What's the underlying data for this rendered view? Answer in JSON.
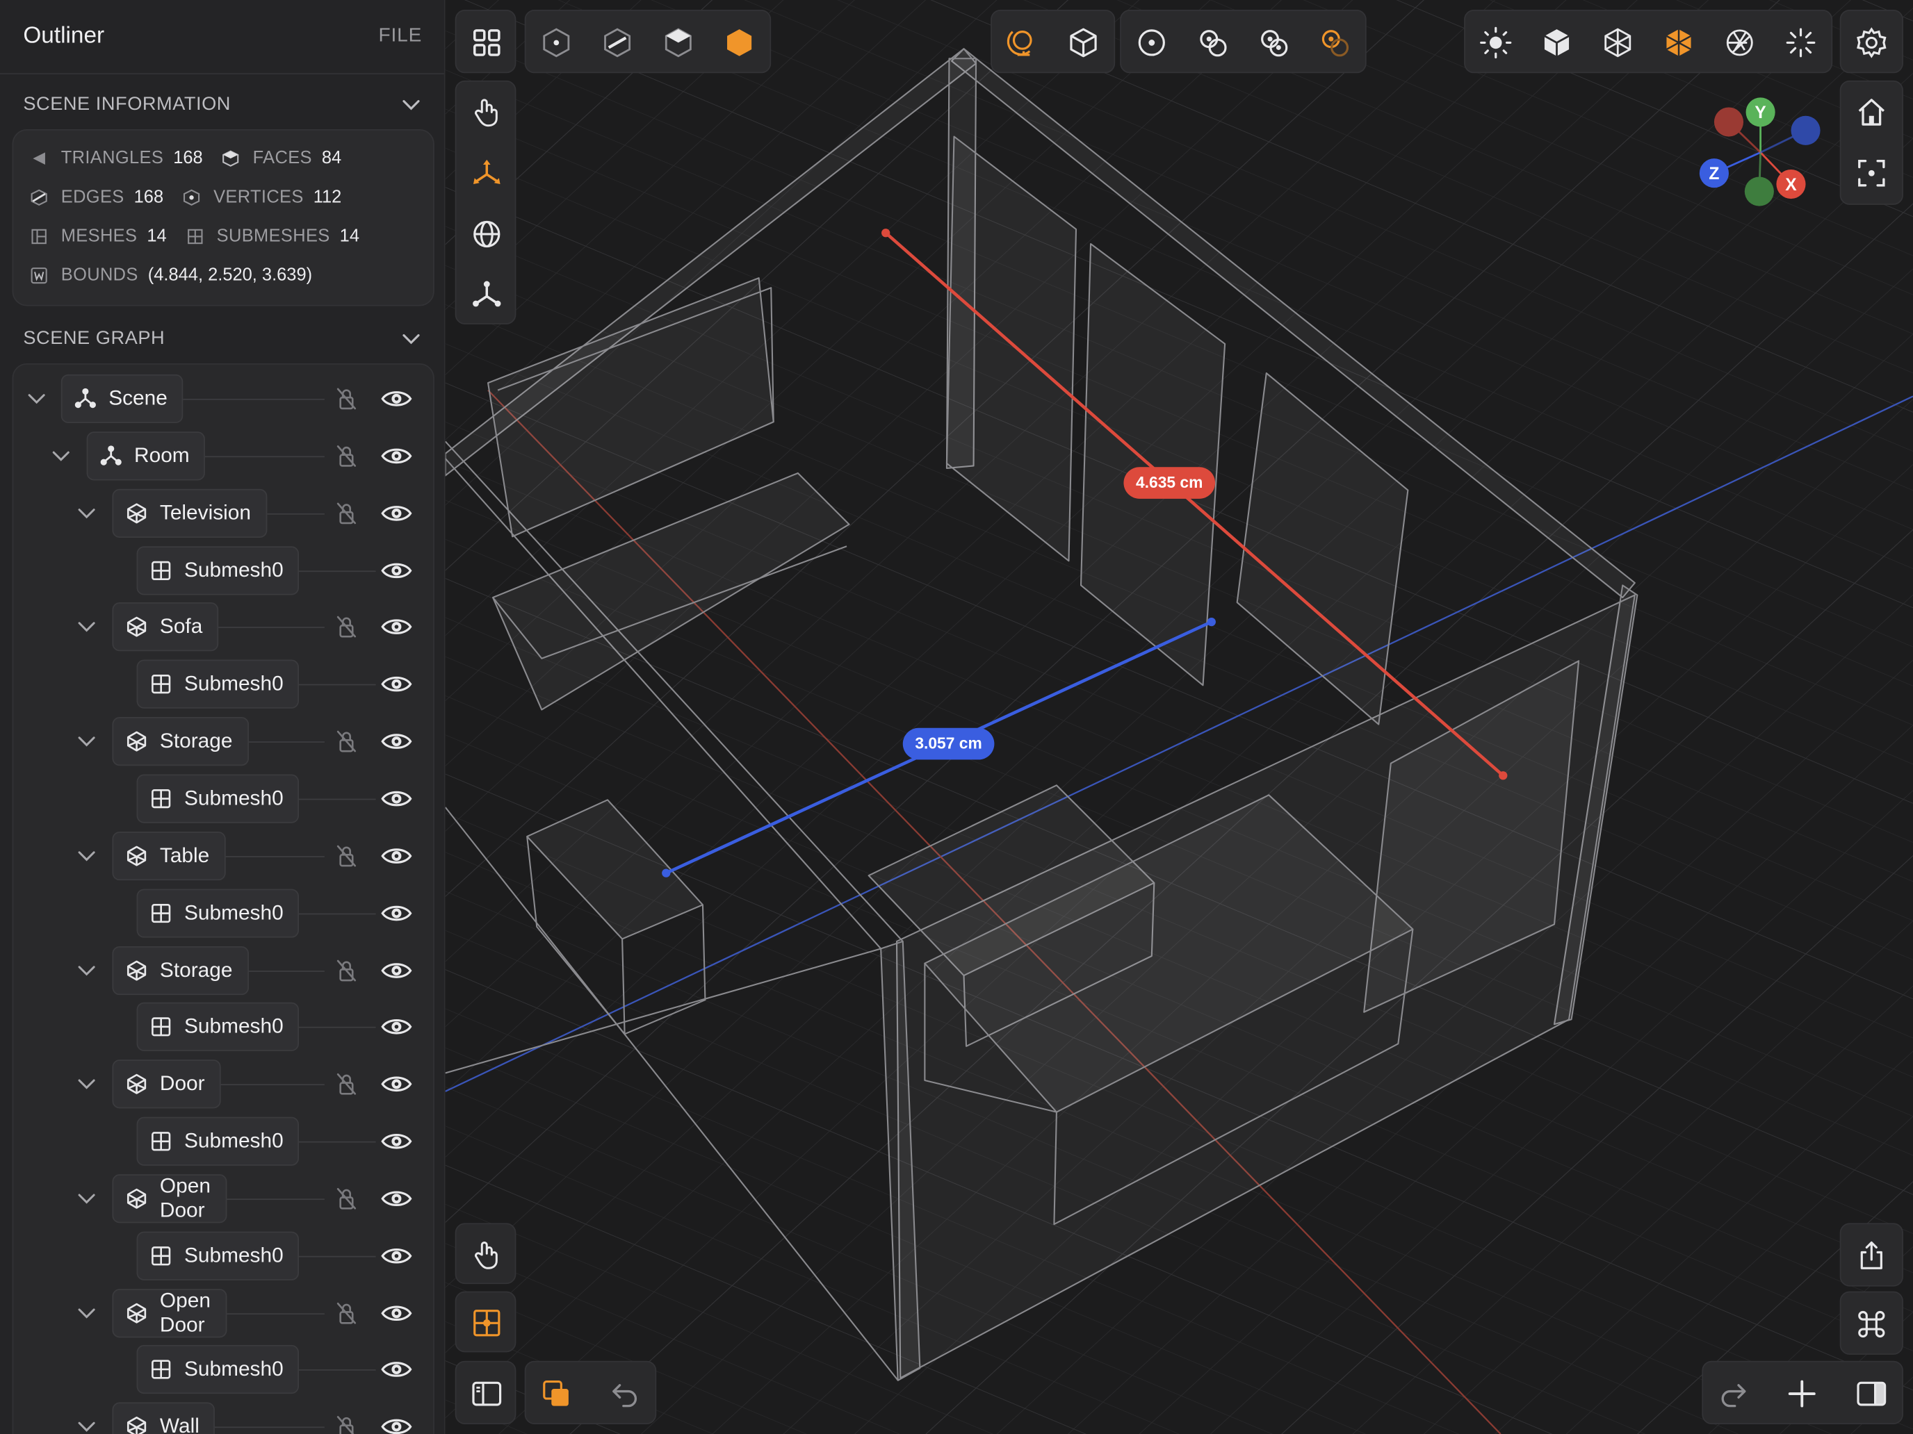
{
  "sidebar": {
    "title": "Outliner",
    "file_label": "FILE",
    "scene_info": {
      "heading": "SCENE INFORMATION",
      "triangles_label": "TRIANGLES",
      "triangles": "168",
      "faces_label": "FACES",
      "faces": "84",
      "edges_label": "EDGES",
      "edges": "168",
      "vertices_label": "VERTICES",
      "vertices": "112",
      "meshes_label": "MESHES",
      "meshes": "14",
      "submeshes_label": "SUBMESHES",
      "submeshes": "14",
      "bounds_label": "BOUNDS",
      "bounds": "(4.844, 2.520, 3.639)"
    },
    "scene_graph": {
      "heading": "SCENE GRAPH",
      "nodes": [
        {
          "label": "Scene",
          "icon": "scene-hierarchy-icon"
        },
        {
          "label": "Room",
          "icon": "scene-hierarchy-icon"
        },
        {
          "label": "Television",
          "icon": "mesh-cube-icon"
        },
        {
          "label": "Submesh0",
          "icon": "submesh-grid-icon"
        },
        {
          "label": "Sofa",
          "icon": "mesh-cube-icon"
        },
        {
          "label": "Submesh0",
          "icon": "submesh-grid-icon"
        },
        {
          "label": "Storage",
          "icon": "mesh-cube-icon"
        },
        {
          "label": "Submesh0",
          "icon": "submesh-grid-icon"
        },
        {
          "label": "Table",
          "icon": "mesh-cube-icon"
        },
        {
          "label": "Submesh0",
          "icon": "submesh-grid-icon"
        },
        {
          "label": "Storage",
          "icon": "mesh-cube-icon"
        },
        {
          "label": "Submesh0",
          "icon": "submesh-grid-icon"
        },
        {
          "label": "Door",
          "icon": "mesh-cube-icon"
        },
        {
          "label": "Submesh0",
          "icon": "submesh-grid-icon"
        },
        {
          "label": "Open Door",
          "icon": "mesh-cube-icon"
        },
        {
          "label": "Submesh0",
          "icon": "submesh-grid-icon"
        },
        {
          "label": "Open Door",
          "icon": "mesh-cube-icon"
        },
        {
          "label": "Submesh0",
          "icon": "submesh-grid-icon"
        },
        {
          "label": "Wall",
          "icon": "mesh-cube-icon"
        }
      ]
    }
  },
  "viewport": {
    "measure_red": "4.635 cm",
    "measure_blue": "3.057 cm",
    "gizmo": {
      "y": "Y",
      "x": "X",
      "z": "Z"
    },
    "colors": {
      "accent": "#f0952a",
      "measure_red": "#dd4a3c",
      "measure_blue": "#3a5ee0",
      "axis_y": "#5ab35a"
    }
  }
}
